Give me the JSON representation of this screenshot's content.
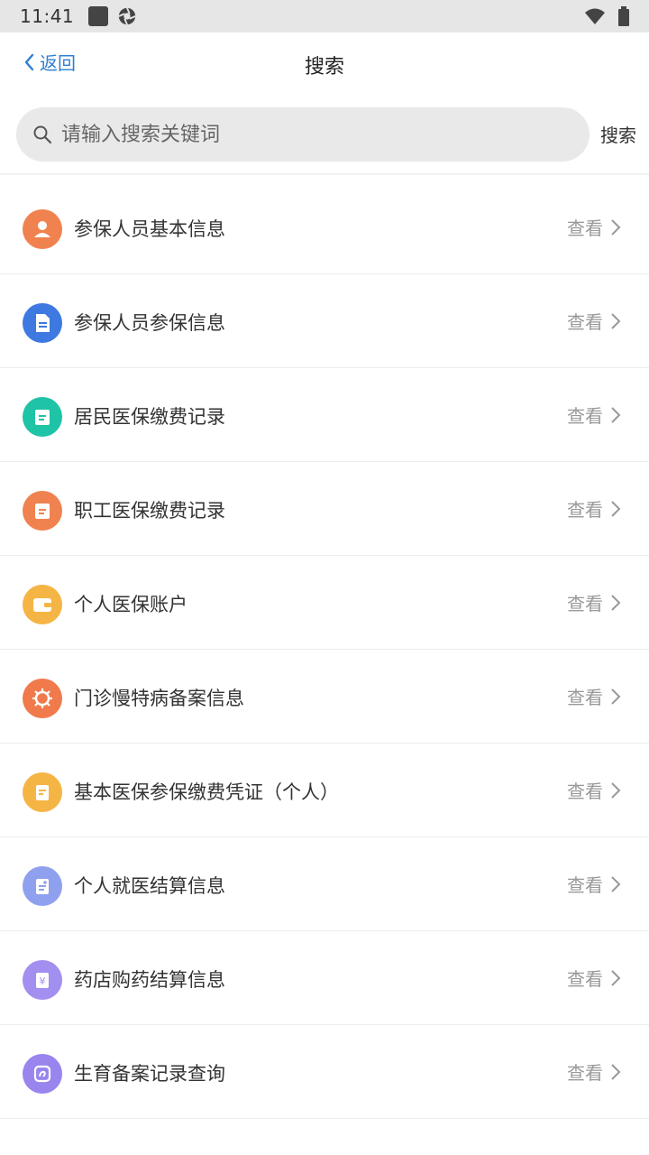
{
  "status_bar": {
    "time": "11:41"
  },
  "header": {
    "back_label": "返回",
    "title": "搜索"
  },
  "search": {
    "placeholder": "请输入搜索关键词",
    "value": "",
    "button_label": "搜索"
  },
  "items": [
    {
      "label": "参保人员基本信息",
      "action": "查看",
      "icon": "person-icon",
      "color": "#f0824f"
    },
    {
      "label": "参保人员参保信息",
      "action": "查看",
      "icon": "document-icon",
      "color": "#3d79e0"
    },
    {
      "label": "居民医保缴费记录",
      "action": "查看",
      "icon": "receipt-icon",
      "color": "#1fc3a5"
    },
    {
      "label": "职工医保缴费记录",
      "action": "查看",
      "icon": "receipt-icon",
      "color": "#f0824f"
    },
    {
      "label": "个人医保账户",
      "action": "查看",
      "icon": "wallet-icon",
      "color": "#f5b545"
    },
    {
      "label": "门诊慢特病备案信息",
      "action": "查看",
      "icon": "virus-icon",
      "color": "#f07a4c"
    },
    {
      "label": "基本医保参保缴费凭证（个人）",
      "action": "查看",
      "icon": "certificate-icon",
      "color": "#f5b545"
    },
    {
      "label": "个人就医结算信息",
      "action": "查看",
      "icon": "medical-record-icon",
      "color": "#8fa0ef"
    },
    {
      "label": "药店购药结算信息",
      "action": "查看",
      "icon": "yuan-receipt-icon",
      "color": "#a28ff0"
    },
    {
      "label": "生育备案记录查询",
      "action": "查看",
      "icon": "maternity-icon",
      "color": "#9a84ee"
    }
  ]
}
